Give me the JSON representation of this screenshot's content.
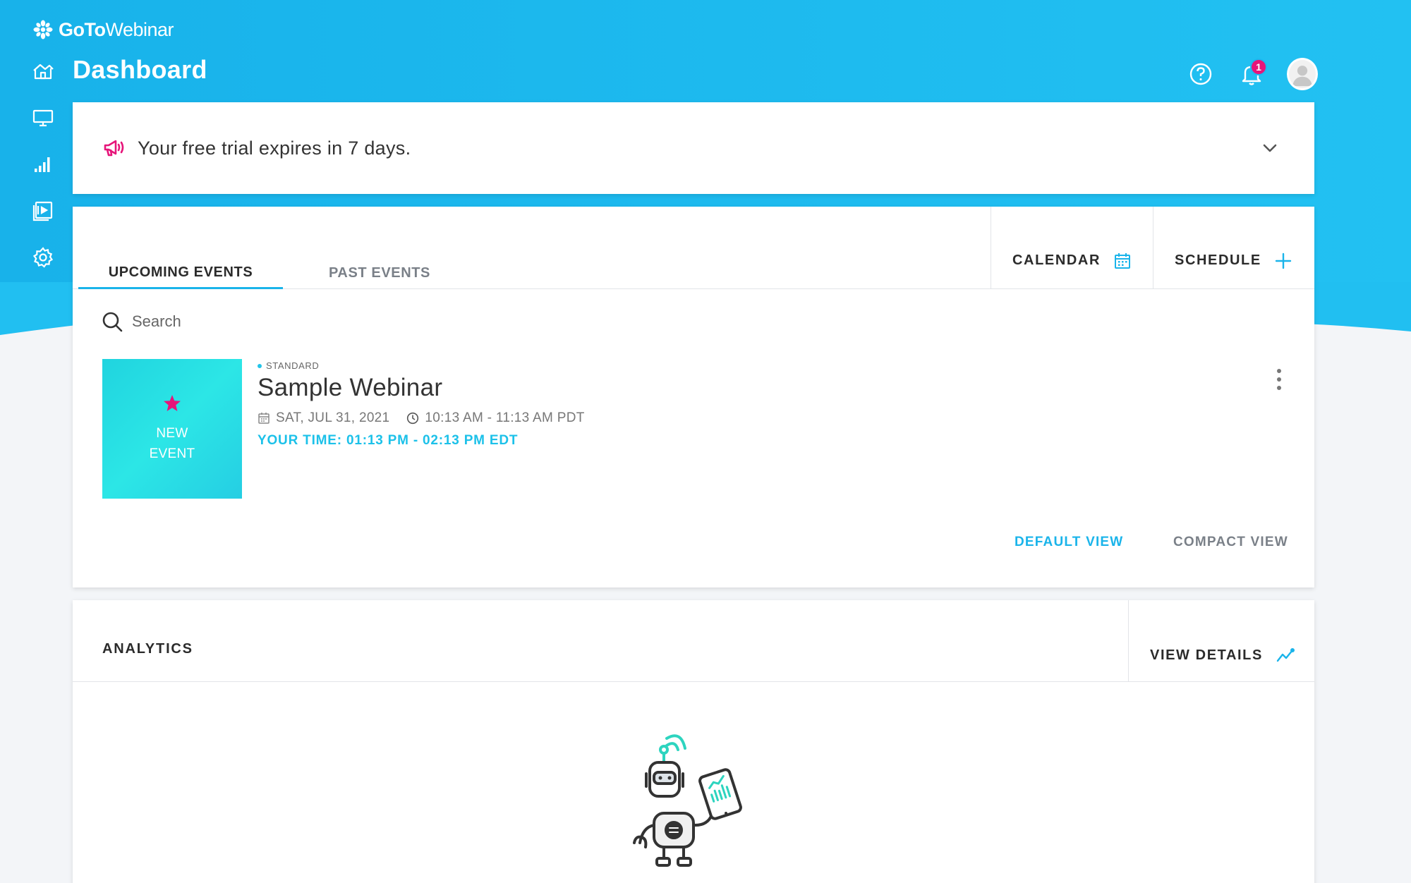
{
  "app": {
    "logo_bold": "GoTo",
    "logo_light": "Webinar",
    "brand_color": "#1ab4ea",
    "accent_pink": "#e6157a"
  },
  "sidebar": {
    "items": [
      {
        "name": "home",
        "icon": "home-icon"
      },
      {
        "name": "webinars",
        "icon": "monitor-icon"
      },
      {
        "name": "analytics",
        "icon": "bar-chart-icon"
      },
      {
        "name": "recordings",
        "icon": "video-library-icon"
      },
      {
        "name": "settings",
        "icon": "gear-icon"
      }
    ]
  },
  "header": {
    "title": "Dashboard",
    "notification_count": "1"
  },
  "trial_banner": {
    "text": "Your free trial expires in 7 days."
  },
  "events": {
    "tabs": [
      {
        "label": "UPCOMING EVENTS",
        "active": true
      },
      {
        "label": "PAST EVENTS",
        "active": false
      }
    ],
    "calendar_label": "CALENDAR",
    "schedule_label": "SCHEDULE",
    "search_placeholder": "Search",
    "items": [
      {
        "thumb_line1": "NEW",
        "thumb_line2": "EVENT",
        "type": "STANDARD",
        "title": "Sample Webinar",
        "date": "SAT, JUL 31, 2021",
        "time": "10:13 AM - 11:13 AM PDT",
        "your_time": "YOUR TIME: 01:13 PM - 02:13 PM EDT"
      }
    ],
    "default_view_label": "DEFAULT VIEW",
    "compact_view_label": "COMPACT VIEW"
  },
  "analytics": {
    "title": "ANALYTICS",
    "view_details_label": "VIEW DETAILS"
  }
}
